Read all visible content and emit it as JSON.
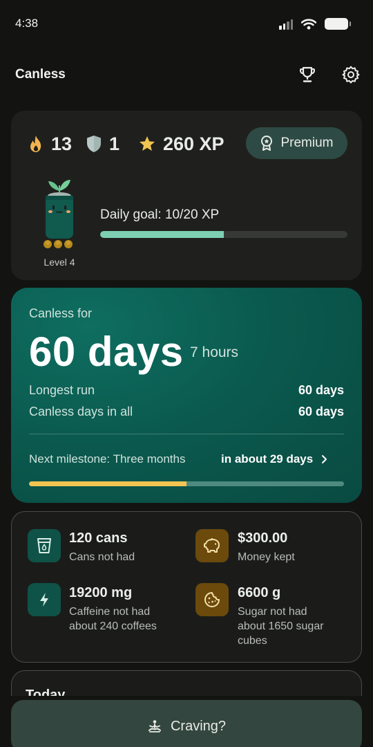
{
  "status_bar": {
    "time": "4:38"
  },
  "header": {
    "title": "Canless"
  },
  "progress": {
    "streak_fire": "13",
    "shields": "1",
    "xp": "260 XP",
    "premium_label": "Premium",
    "level_label": "Level 4",
    "daily_goal": "Daily goal: 10/20 XP",
    "daily_goal_fraction": 0.5
  },
  "streak": {
    "label": "Canless for",
    "days": "60 days",
    "hours": "7 hours",
    "longest_run_label": "Longest run",
    "longest_run_value": "60 days",
    "total_label": "Canless days in all",
    "total_value": "60 days",
    "milestone_label": "Next milestone: Three months",
    "milestone_when": "in about 29 days",
    "milestone_fraction": 0.5
  },
  "savings": {
    "cans_value": "120 cans",
    "cans_label": "Cans not had",
    "money_value": "$300.00",
    "money_label": "Money kept",
    "caffeine_value": "19200 mg",
    "caffeine_label": "Caffeine not had",
    "caffeine_note": "about 240 coffees",
    "sugar_value": "6600 g",
    "sugar_label": "Sugar not had",
    "sugar_note_1": "about 1650 sugar",
    "sugar_note_2": "cubes"
  },
  "today": {
    "title": "Today"
  },
  "craving_button": {
    "label": "Craving?"
  },
  "colors": {
    "background": "#131412",
    "card": "#1f201d",
    "streak_card": "#0b5a4f",
    "accent_mint": "#7dcfb4",
    "accent_gold": "#f2c451",
    "button": "#33463f"
  },
  "icons": {
    "trophy": "trophy-icon",
    "settings": "gear-icon",
    "fire": "fire-icon",
    "shield": "shield-icon",
    "star": "star-icon",
    "premium": "badge-icon",
    "cup": "cup-icon",
    "piggy": "piggy-bank-icon",
    "bolt": "bolt-icon",
    "cookie": "cookie-icon",
    "meditation": "meditation-icon"
  }
}
